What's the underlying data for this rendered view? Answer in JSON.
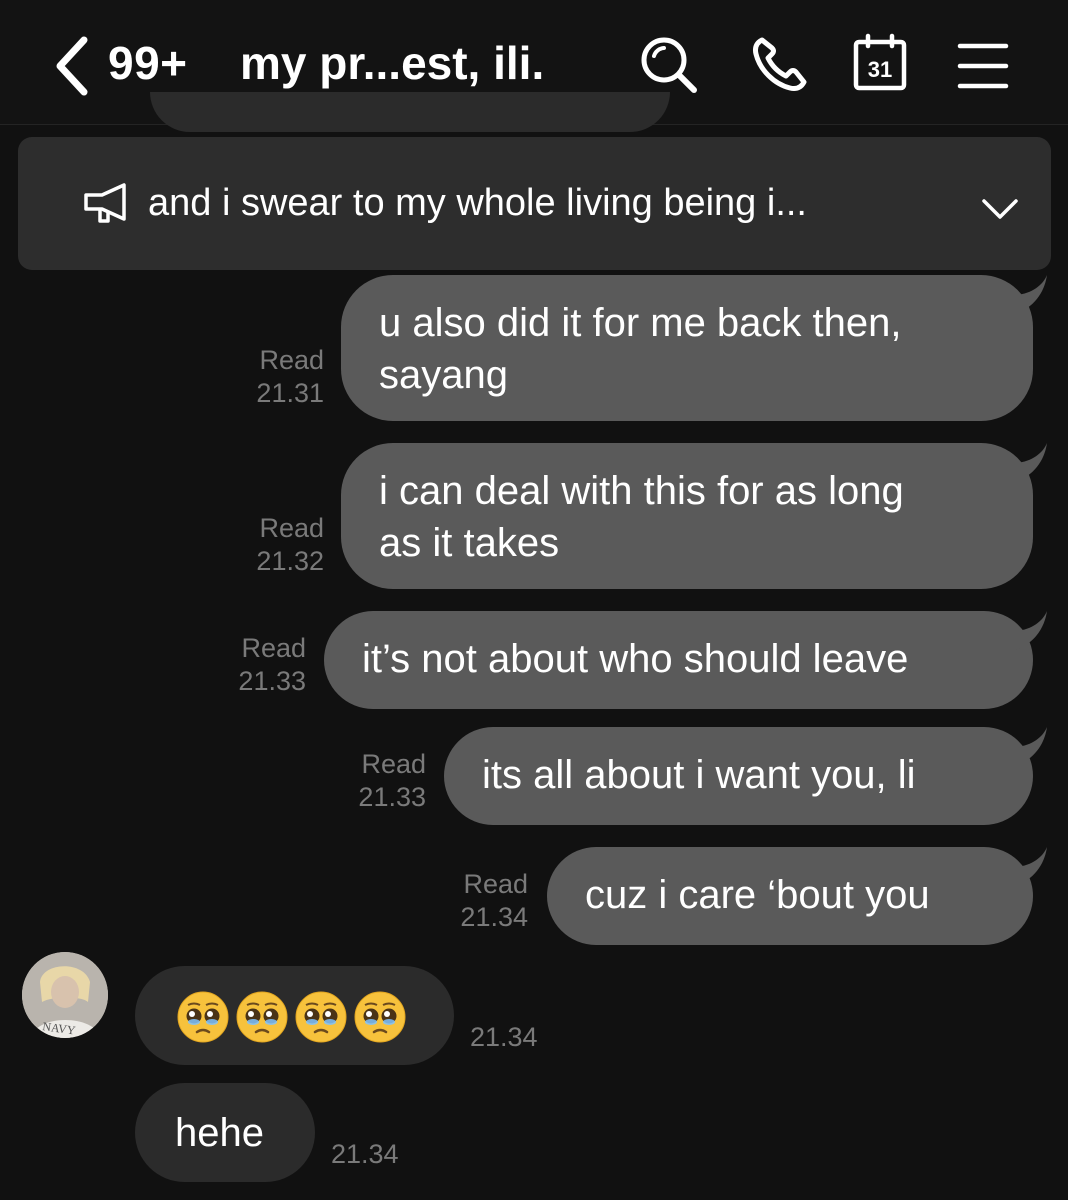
{
  "header": {
    "unread_count": "99+",
    "title": "my pr...est, ili.",
    "calendar_day": "31"
  },
  "announcement": {
    "text": "and i swear to my whole living being i..."
  },
  "messages": [
    {
      "text": "u also did it for me back then,\nsayang",
      "status": "Read",
      "time": "21.31"
    },
    {
      "text": "i can deal with this for as long\nas it takes",
      "status": "Read",
      "time": "21.32"
    },
    {
      "text": "it’s not about who should leave",
      "status": "Read",
      "time": "21.33"
    },
    {
      "text": "its all about i want you, li",
      "status": "Read",
      "time": "21.33"
    },
    {
      "text": "cuz i care ‘bout you",
      "status": "Read",
      "time": "21.34"
    }
  ],
  "received": [
    {
      "text": "🥺🥺🥺🥺",
      "emoji_name": "pleading-face",
      "emoji_count": 4,
      "time": "21.34"
    },
    {
      "text": "hehe",
      "time": "21.34"
    }
  ],
  "colors": {
    "background": "#111111",
    "sent_bubble": "#5a5a5a",
    "received_bubble": "#2b2b2b",
    "announcement_bg": "#2d2d2d",
    "meta_text": "#7a7a7a"
  }
}
